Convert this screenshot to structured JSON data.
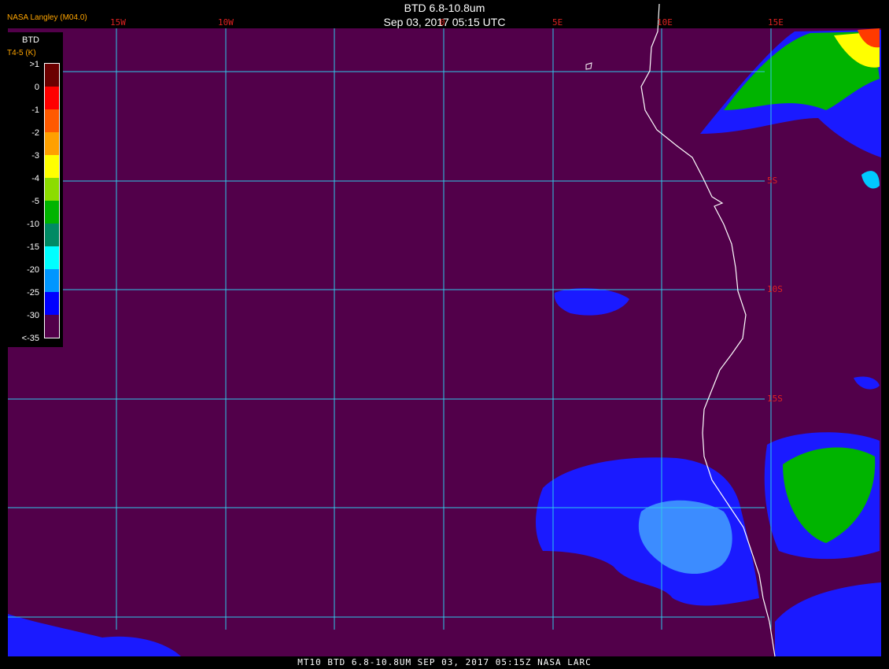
{
  "header": {
    "title": "BTD 6.8-10.8um",
    "datetime": "Sep 03, 2017 05:15 UTC",
    "credit": "NASA Langley (M04.0)"
  },
  "footer": {
    "text": "MT10  BTD 6.8-10.8UM  SEP 03, 2017 05:15Z  NASA LARC"
  },
  "legend": {
    "title": "BTD",
    "subtitle": "T4-5 (K)",
    "ticks": [
      ">1",
      "0",
      "-1",
      "-2",
      "-3",
      "-4",
      "-5",
      "-10",
      "-15",
      "-20",
      "-25",
      "-30",
      "<-35"
    ],
    "colors": [
      "#6b0000",
      "#ff0000",
      "#ff5a00",
      "#ffa000",
      "#ffff00",
      "#8cdc00",
      "#00b400",
      "#008a64",
      "#00ffff",
      "#0096ff",
      "#0000ff",
      "#52004a"
    ]
  },
  "map": {
    "background_color": "#52004a",
    "grid_color": "#2fc8e8",
    "coast_color": "#ffffff",
    "lon_labels": [
      "15W",
      "10W",
      "0",
      "5E",
      "10E",
      "15E"
    ],
    "lat_labels": [
      "5S",
      "10S",
      "15S"
    ]
  }
}
